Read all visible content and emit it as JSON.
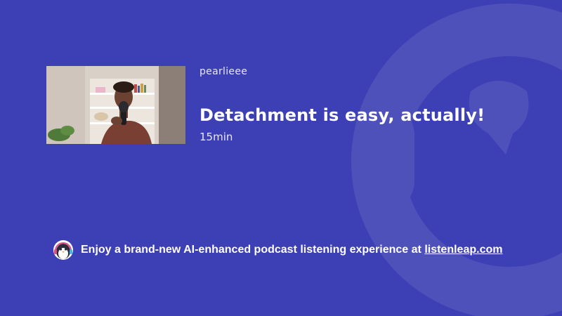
{
  "colors": {
    "background": "#3d3fb5",
    "text": "#ffffff",
    "muted_text": "#e8e8f6"
  },
  "episode": {
    "thumbnail_icon": "podcast-thumbnail-image",
    "author": "pearlieee",
    "title": "Detachment is easy, actually!",
    "duration": "15min"
  },
  "promo": {
    "logo_icon": "penguin-headphones-icon",
    "text": "Enjoy a brand-new AI-enhanced podcast listening experience at",
    "link_label": "listenleap.com"
  },
  "background_mark_icon": "headphones-watermark-icon"
}
